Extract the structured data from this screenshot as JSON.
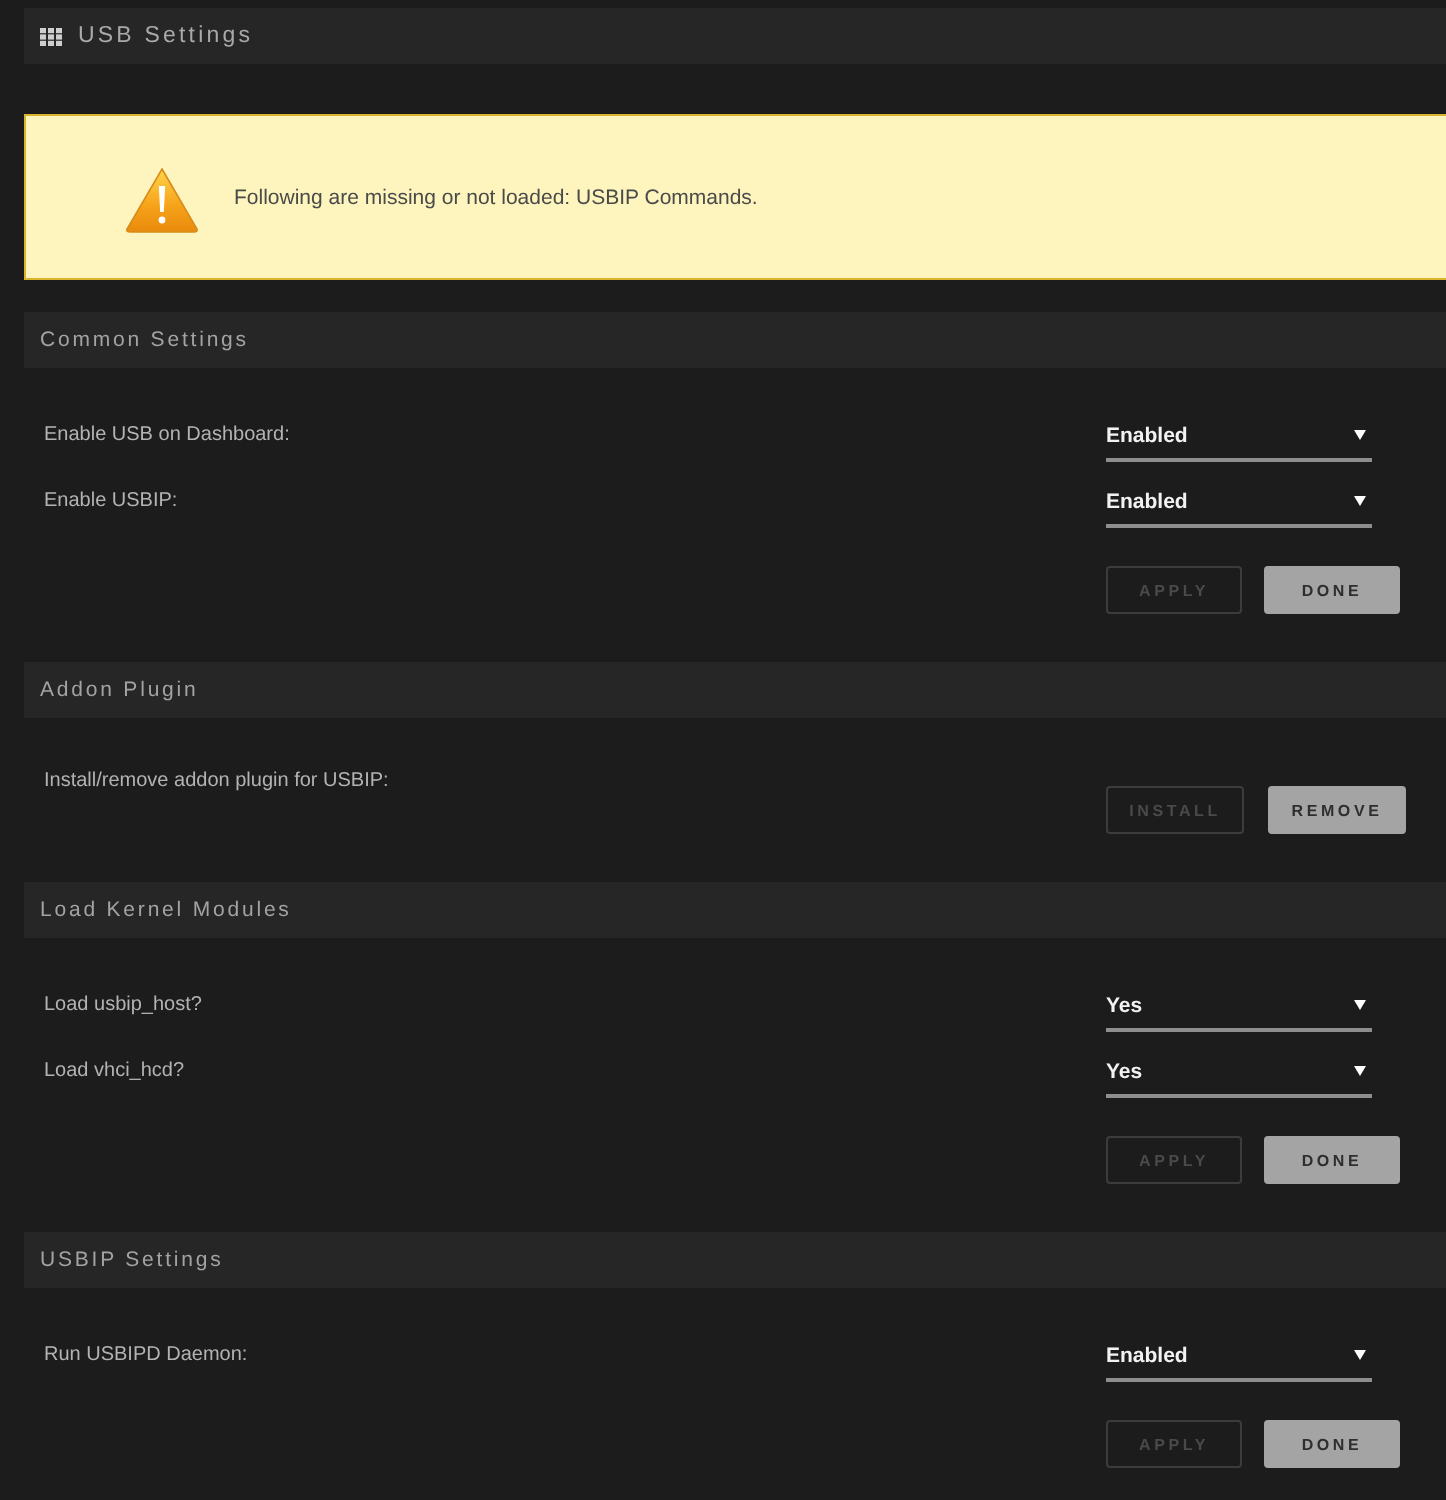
{
  "header": {
    "title": "USB Settings"
  },
  "alert": {
    "message": "Following are missing or not loaded: USBIP Commands."
  },
  "sections": [
    {
      "title": "Common Settings",
      "rows": [
        {
          "kind": "select",
          "label": "Enable USB on Dashboard:",
          "value": "Enabled"
        },
        {
          "kind": "select",
          "label": "Enable USBIP:",
          "value": "Enabled"
        }
      ],
      "buttons": [
        {
          "label": "APPLY",
          "disabled": true
        },
        {
          "label": "DONE",
          "disabled": false
        }
      ]
    },
    {
      "title": "Addon Plugin",
      "rows": [
        {
          "kind": "buttons",
          "label": "Install/remove addon plugin for USBIP:",
          "buttons": [
            {
              "label": "INSTALL",
              "disabled": true
            },
            {
              "label": "REMOVE",
              "disabled": false
            }
          ]
        }
      ]
    },
    {
      "title": "Load Kernel Modules",
      "rows": [
        {
          "kind": "select",
          "label": "Load usbip_host?",
          "value": "Yes"
        },
        {
          "kind": "select",
          "label": "Load vhci_hcd?",
          "value": "Yes"
        }
      ],
      "buttons": [
        {
          "label": "APPLY",
          "disabled": true
        },
        {
          "label": "DONE",
          "disabled": false
        }
      ]
    },
    {
      "title": "USBIP Settings",
      "rows": [
        {
          "kind": "select",
          "label": "Run USBIPD Daemon:",
          "value": "Enabled"
        }
      ],
      "buttons": [
        {
          "label": "APPLY",
          "disabled": true
        },
        {
          "label": "DONE",
          "disabled": false
        }
      ]
    }
  ]
}
